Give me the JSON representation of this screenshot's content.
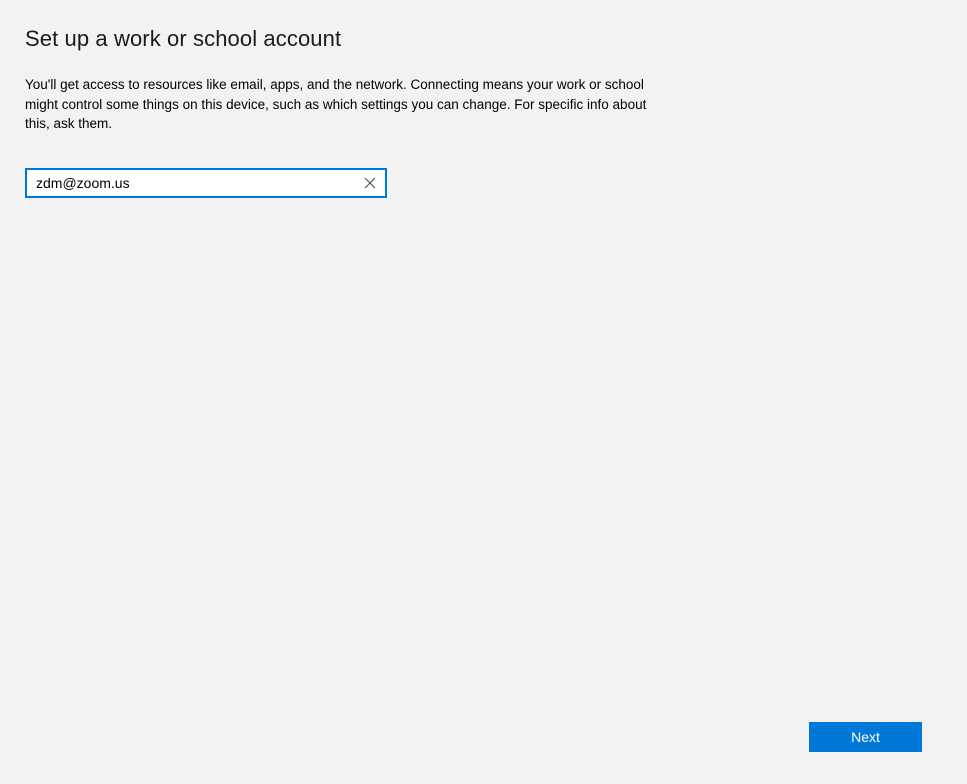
{
  "header": {
    "title": "Set up a work or school account"
  },
  "main": {
    "description": "You'll get access to resources like email, apps, and the network. Connecting means your work or school might control some things on this device, such as which settings you can change. For specific info about this, ask them.",
    "email_input": {
      "value": "zdm@zoom.us",
      "clear_icon": "close-icon"
    }
  },
  "footer": {
    "next_label": "Next"
  },
  "colors": {
    "accent": "#0078d7",
    "background": "#f2f2f2"
  }
}
